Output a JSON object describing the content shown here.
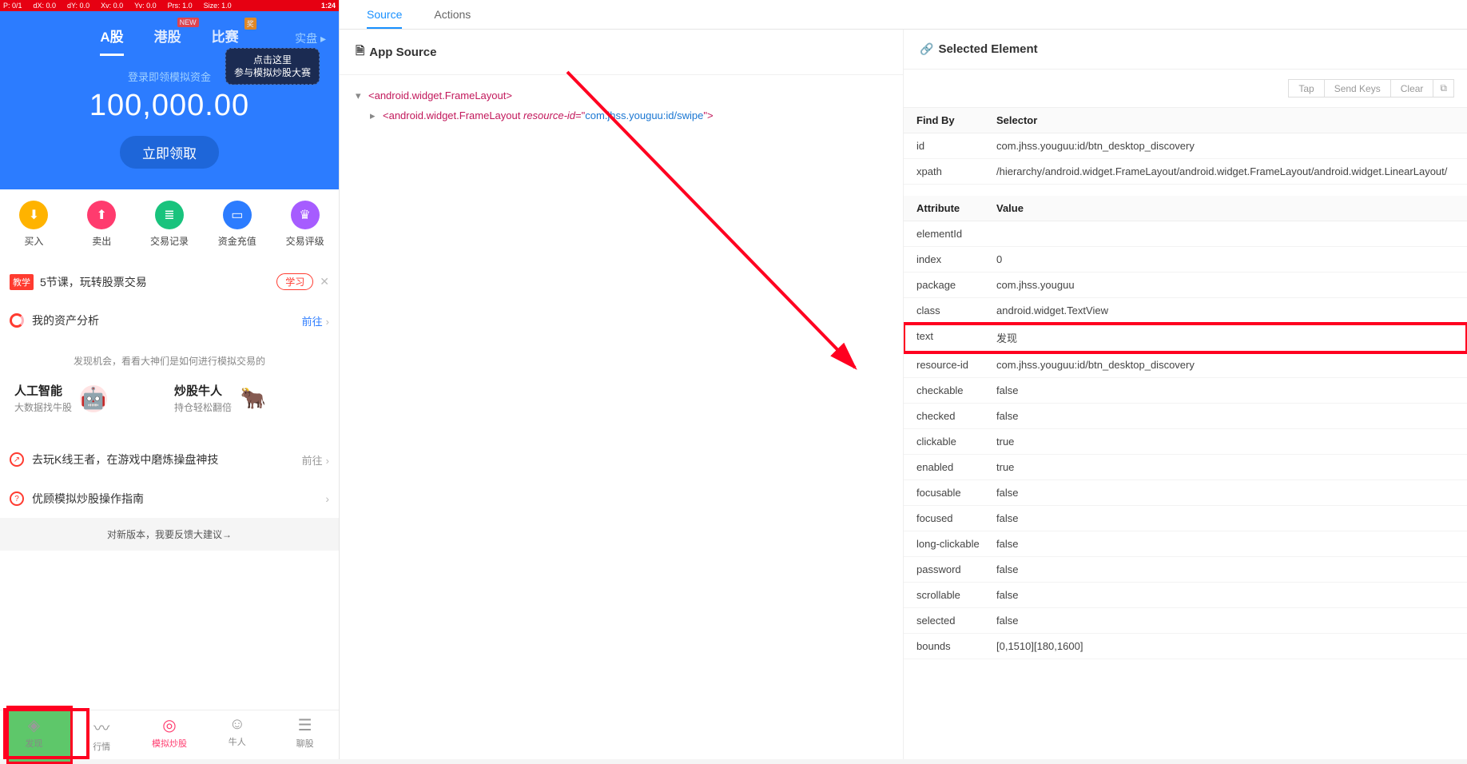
{
  "status_bar": {
    "p": "P: 0/1",
    "dx": "dX: 0.0",
    "dy": "dY: 0.0",
    "xv": "Xv: 0.0",
    "yv": "Yv: 0.0",
    "prs": "Prs: 1.0",
    "size": "Size: 1.0",
    "time": "1:24"
  },
  "market_tabs": {
    "a": "A股",
    "hk": "港股",
    "hk_badge": "NEW",
    "match": "比赛",
    "match_badge": "奖",
    "live": "实盘 ▸"
  },
  "hero": {
    "login_tip": "登录即领模拟资金",
    "amount": "100,000.00",
    "claim": "立即领取",
    "bubble_line1": "点击这里",
    "bubble_line2": "参与模拟炒股大赛"
  },
  "icons": {
    "buy": "买入",
    "sell": "卖出",
    "history": "交易记录",
    "fund": "资金充值",
    "rate": "交易评级"
  },
  "lesson": {
    "tag": "教学",
    "text": "5节课，玩转股票交易",
    "study": "学习",
    "close": "✕"
  },
  "asset": {
    "title": "我的资产分析",
    "go": "前往"
  },
  "discover_hint": "发现机会，看看大神们是如何进行模拟交易的",
  "discover": {
    "ai_title": "人工智能",
    "ai_sub": "大数据找牛股",
    "god_title": "炒股牛人",
    "god_sub": "持仓轻松翻倍"
  },
  "kline": {
    "text": "去玩K线王者，在游戏中磨炼操盘神技",
    "go": "前往"
  },
  "guide": {
    "text": "优顾模拟炒股操作指南"
  },
  "feedback": "对新版本，我要反馈大建议→",
  "nav": {
    "discovery": "发现",
    "market": "行情",
    "trade": "模拟炒股",
    "master": "牛人",
    "chat": "聊股"
  },
  "tabs": {
    "source": "Source",
    "actions": "Actions"
  },
  "source_title": "App Source",
  "tree": {
    "root": "android.widget.FrameLayout",
    "child": "android.widget.FrameLayout",
    "attr_name": "resource-id",
    "attr_val": "com.jhss.youguu:id/swipe"
  },
  "selected_title": "Selected Element",
  "btns": {
    "tap": "Tap",
    "send": "Send Keys",
    "clear": "Clear",
    "copy": "⧉"
  },
  "sel_head": {
    "find": "Find By",
    "selector": "Selector"
  },
  "selectors": [
    {
      "k": "id",
      "v": "com.jhss.youguu:id/btn_desktop_discovery"
    },
    {
      "k": "xpath",
      "v": "/hierarchy/android.widget.FrameLayout/android.widget.FrameLayout/android.widget.LinearLayout/"
    }
  ],
  "attr_head": {
    "attr": "Attribute",
    "val": "Value"
  },
  "attributes": [
    {
      "k": "elementId",
      "v": ""
    },
    {
      "k": "index",
      "v": "0"
    },
    {
      "k": "package",
      "v": "com.jhss.youguu"
    },
    {
      "k": "class",
      "v": "android.widget.TextView"
    },
    {
      "k": "text",
      "v": "发现",
      "hilite": true
    },
    {
      "k": "resource-id",
      "v": "com.jhss.youguu:id/btn_desktop_discovery"
    },
    {
      "k": "checkable",
      "v": "false"
    },
    {
      "k": "checked",
      "v": "false"
    },
    {
      "k": "clickable",
      "v": "true"
    },
    {
      "k": "enabled",
      "v": "true"
    },
    {
      "k": "focusable",
      "v": "false"
    },
    {
      "k": "focused",
      "v": "false"
    },
    {
      "k": "long-clickable",
      "v": "false"
    },
    {
      "k": "password",
      "v": "false"
    },
    {
      "k": "scrollable",
      "v": "false"
    },
    {
      "k": "selected",
      "v": "false"
    },
    {
      "k": "bounds",
      "v": "[0,1510][180,1600]"
    }
  ]
}
